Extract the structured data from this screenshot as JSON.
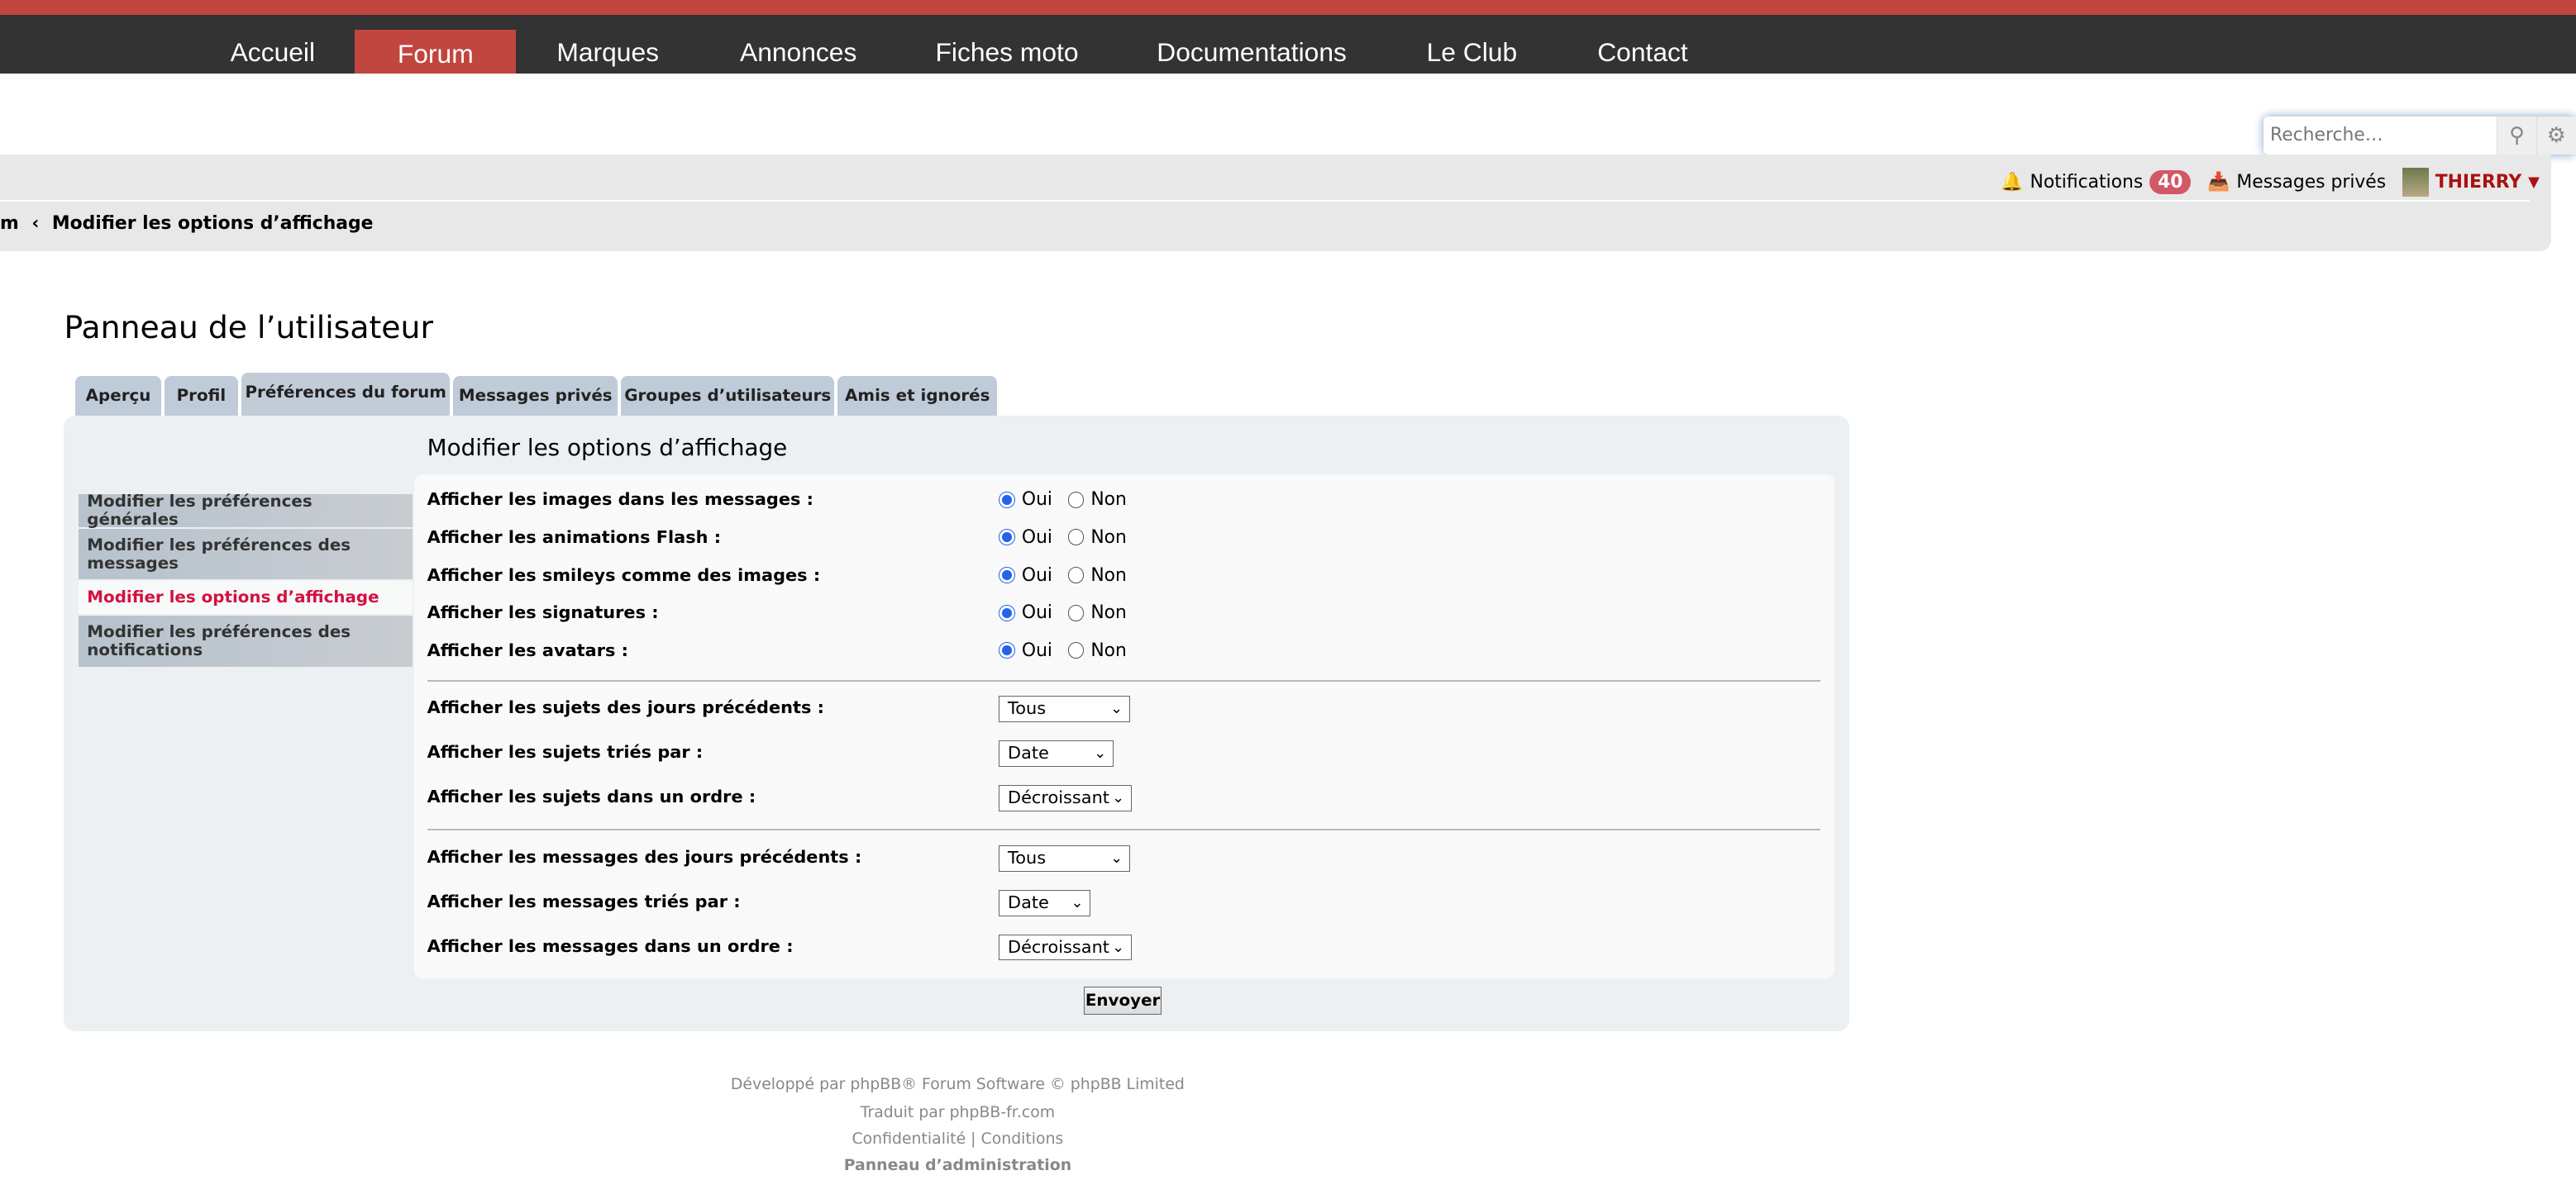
{
  "nav": {
    "items": [
      "Accueil",
      "Forum",
      "Marques",
      "Annonces",
      "Fiches moto",
      "Documentations",
      "Le Club",
      "Contact"
    ],
    "active": "Forum"
  },
  "search": {
    "placeholder": "Recherche…"
  },
  "user": {
    "notifications_label": "Notifications",
    "notifications_count": "40",
    "messages_label": "Messages privés",
    "username": "THIERRY"
  },
  "breadcrumb": {
    "prefix": "m",
    "sep": "‹",
    "current": "Modifier les options d’affichage"
  },
  "page_title": "Panneau de l’utilisateur",
  "tabs": [
    "Aperçu",
    "Profil",
    "Préférences du forum",
    "Messages privés",
    "Groupes d’utilisateurs",
    "Amis et ignorés"
  ],
  "menu": [
    "Modifier les préférences générales",
    "Modifier les préférences des messages",
    "Modifier les options d’affichage",
    "Modifier les préférences des notifications"
  ],
  "section_title": "Modifier les options d’affichage",
  "radio_rows": [
    {
      "label": "Afficher les images dans les messages :",
      "value": "Oui"
    },
    {
      "label": "Afficher les animations Flash :",
      "value": "Oui"
    },
    {
      "label": "Afficher les smileys comme des images :",
      "value": "Oui"
    },
    {
      "label": "Afficher les signatures :",
      "value": "Oui"
    },
    {
      "label": "Afficher les avatars :",
      "value": "Oui"
    }
  ],
  "radio_options": [
    "Oui",
    "Non"
  ],
  "select_rows": [
    {
      "label": "Afficher les sujets des jours précédents :",
      "value": "Tous"
    },
    {
      "label": "Afficher les sujets triés par :",
      "value": "Date"
    },
    {
      "label": "Afficher les sujets dans un ordre :",
      "value": "Décroissant"
    },
    {
      "label": "Afficher les messages des jours précédents :",
      "value": "Tous"
    },
    {
      "label": "Afficher les messages triés par :",
      "value": "Date"
    },
    {
      "label": "Afficher les messages dans un ordre :",
      "value": "Décroissant"
    }
  ],
  "submit": "Envoyer",
  "footer": {
    "line1": "Développé par phpBB® Forum Software © phpBB Limited",
    "line2": "Traduit par phpBB-fr.com",
    "privacy": "Confidentialité",
    "sep": "|",
    "terms": "Conditions",
    "admin": "Panneau d’administration"
  },
  "colors": {
    "accent": "#c0463f",
    "nav_bg": "#333333",
    "active_menu": "#d31141",
    "badge": "#d15865",
    "username": "#aa1111"
  },
  "icons": {
    "notifications": "bell-icon",
    "messages": "inbox-icon",
    "search": "search-icon",
    "settings": "gear-icon",
    "user_menu": "caret-down-icon"
  }
}
